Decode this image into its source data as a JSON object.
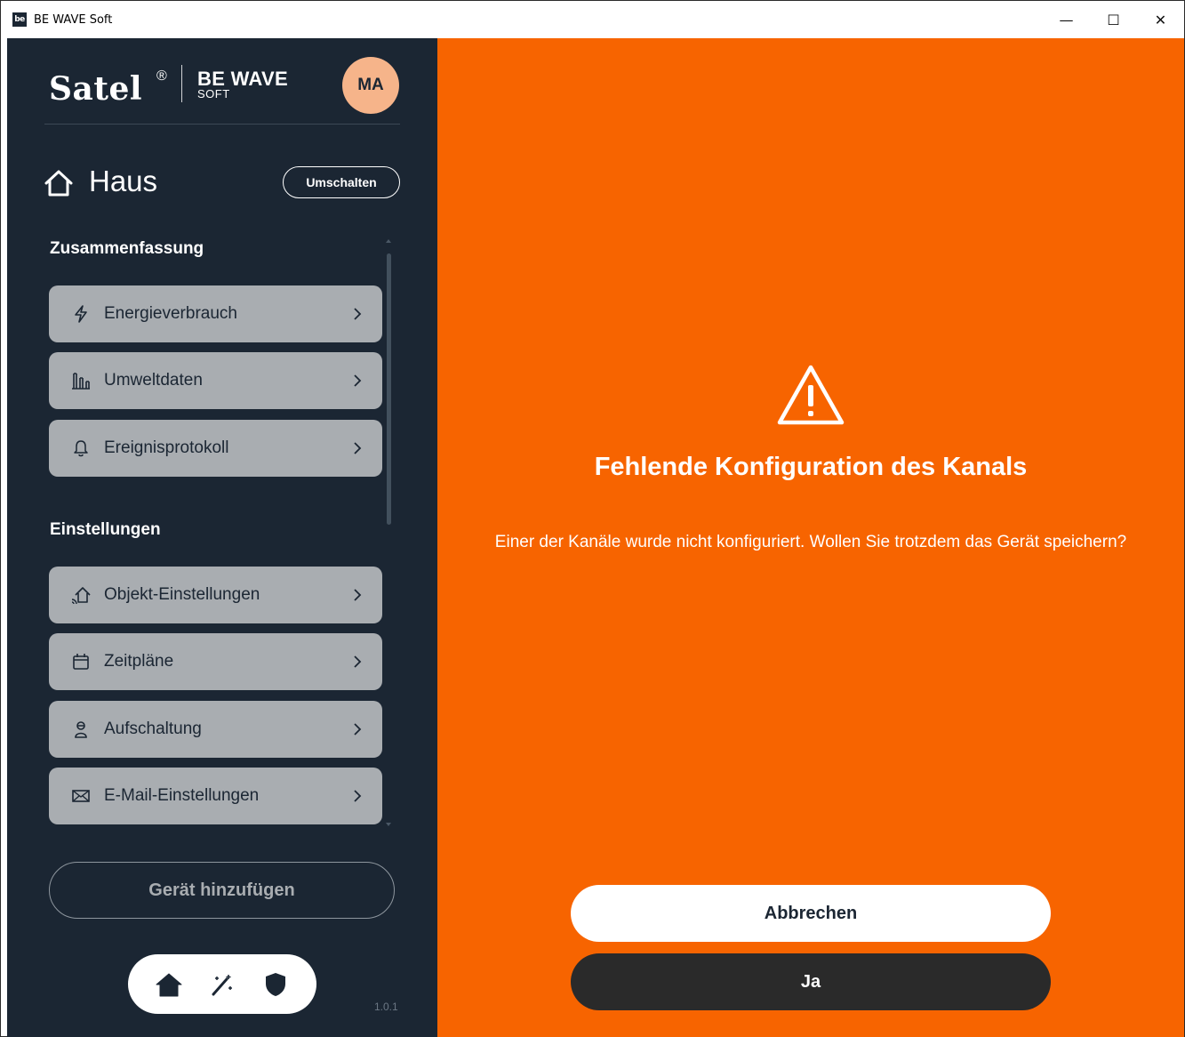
{
  "window": {
    "title": "BE WAVE Soft",
    "app_icon_text": "be",
    "controls": {
      "minimize": "—",
      "maximize": "☐",
      "close": "✕"
    }
  },
  "brand": {
    "logo_text": "Satel",
    "reg_mark": "®",
    "product_name": "BE WAVE",
    "product_sub": "SOFT",
    "avatar_initials": "MA"
  },
  "house": {
    "title": "Haus",
    "switch_label": "Umschalten"
  },
  "sections": {
    "summary": {
      "title": "Zusammenfassung",
      "items": [
        {
          "label": "Energieverbrauch",
          "icon": "lightning-icon"
        },
        {
          "label": "Umweltdaten",
          "icon": "bar-chart-icon"
        },
        {
          "label": "Ereignisprotokoll",
          "icon": "bell-icon"
        }
      ]
    },
    "settings": {
      "title": "Einstellungen",
      "items": [
        {
          "label": "Objekt-Einstellungen",
          "icon": "smart-home-icon"
        },
        {
          "label": "Zeitpläne",
          "icon": "calendar-icon"
        },
        {
          "label": "Aufschaltung",
          "icon": "user-icon"
        },
        {
          "label": "E-Mail-Einstellungen",
          "icon": "envelope-icon"
        }
      ]
    }
  },
  "add_device_label": "Gerät hinzufügen",
  "bottom_nav": [
    "home-icon",
    "magic-wand-icon",
    "shield-icon"
  ],
  "version": "1.0.1",
  "dialog": {
    "title": "Fehlende Konfiguration des Kanals",
    "message": "Einer der Kanäle wurde nicht konfiguriert. Wollen Sie trotzdem das Gerät speichern?",
    "cancel_label": "Abbrechen",
    "confirm_label": "Ja"
  },
  "colors": {
    "sidebar_bg": "#1b2633",
    "main_bg": "#f76400",
    "menu_item_bg": "#a9adb1",
    "avatar_bg": "#f6b48a",
    "confirm_bg": "#2a2a2a"
  }
}
